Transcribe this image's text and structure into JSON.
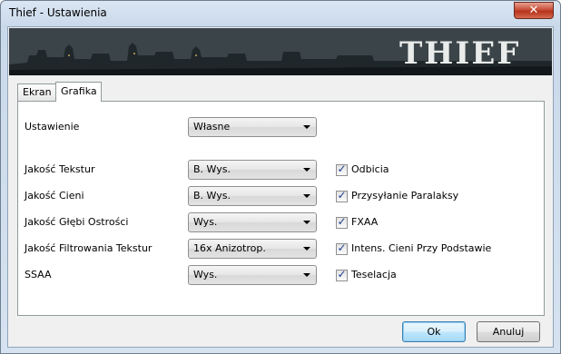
{
  "window": {
    "title": "Thief - Ustawienia",
    "close_glyph": "✕"
  },
  "banner": {
    "logo_text": "THIEF"
  },
  "tabs": [
    {
      "label": "Ekran",
      "active": false
    },
    {
      "label": "Grafika",
      "active": true
    }
  ],
  "settings": {
    "preset": {
      "label": "Ustawienie",
      "value": "Własne"
    },
    "texture_quality": {
      "label": "Jakość Tekstur",
      "value": "B. Wys."
    },
    "shadow_quality": {
      "label": "Jakość Cieni",
      "value": "B. Wys."
    },
    "dof_quality": {
      "label": "Jakość Głębi Ostrości",
      "value": "Wys."
    },
    "texture_filtering": {
      "label": "Jakość Filtrowania Tekstur",
      "value": "16x Anizotrop."
    },
    "ssaa": {
      "label": "SSAA",
      "value": "Wys."
    }
  },
  "options": [
    {
      "label": "Odbicia",
      "checked": true
    },
    {
      "label": "Przysyłanie Paralaksy",
      "checked": true
    },
    {
      "label": "FXAA",
      "checked": true
    },
    {
      "label": "Intens. Cieni Przy Podstawie",
      "checked": true
    },
    {
      "label": "Teselacja",
      "checked": true
    }
  ],
  "buttons": {
    "ok": "Ok",
    "cancel": "Anuluj"
  },
  "icons": {
    "dropdown": "chevron-down-icon",
    "check": "checkmark-icon",
    "close": "close-icon"
  }
}
